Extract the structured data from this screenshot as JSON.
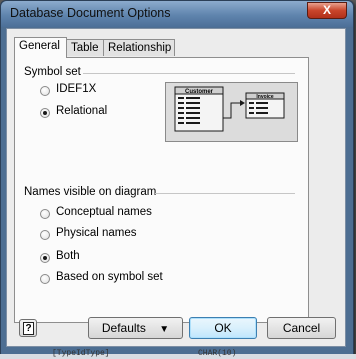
{
  "window": {
    "title": "Database Document Options",
    "close_glyph": "X"
  },
  "tabs": [
    {
      "label": "General",
      "active": true
    },
    {
      "label": "Table",
      "active": false
    },
    {
      "label": "Relationship",
      "active": false
    }
  ],
  "symbol_set": {
    "label": "Symbol set",
    "options": [
      {
        "label": "IDEF1X",
        "checked": false
      },
      {
        "label": "Relational",
        "checked": true
      }
    ],
    "preview": {
      "left_entity_title": "Customer",
      "right_entity_title": "Invoice"
    }
  },
  "names_visible": {
    "label": "Names visible on diagram",
    "options": [
      {
        "label": "Conceptual names",
        "checked": false
      },
      {
        "label": "Physical names",
        "checked": false
      },
      {
        "label": "Both",
        "checked": true
      },
      {
        "label": "Based on symbol set",
        "checked": false
      }
    ]
  },
  "buttons": {
    "help_glyph": "?",
    "defaults": "Defaults",
    "defaults_arrow": "▼",
    "ok": "OK",
    "cancel": "Cancel"
  },
  "background_fragments": {
    "left": "[TypeIdType]",
    "right": "CHAR(10)"
  }
}
